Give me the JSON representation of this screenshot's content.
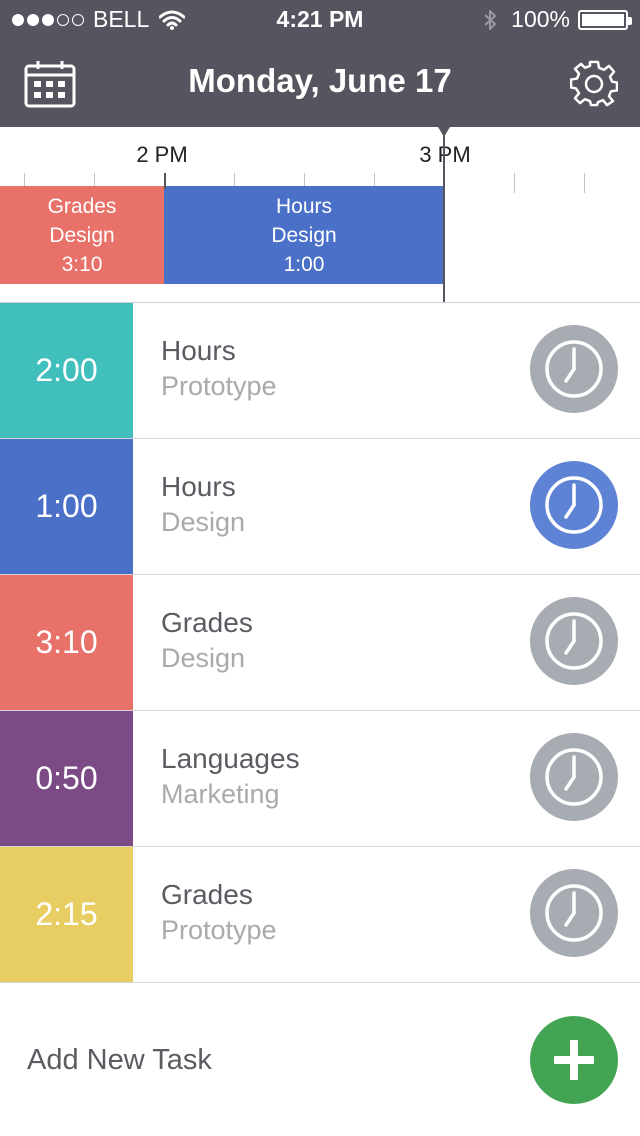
{
  "status_bar": {
    "carrier": "BELL",
    "time": "4:21 PM",
    "battery": "100%",
    "battery_level": 1.0,
    "signal_bars": 3,
    "signal_total": 5
  },
  "nav": {
    "title": "Monday, June 17",
    "calendar_icon": "calendar-icon",
    "settings_icon": "gear-icon"
  },
  "timeline": {
    "labels": [
      "2 PM",
      "3 PM"
    ],
    "blocks": [
      {
        "project": "Grades",
        "type": "Design",
        "duration": "3:10",
        "color": "#e8716a"
      },
      {
        "project": "Hours",
        "type": "Design",
        "duration": "1:00",
        "color": "#4a70c8"
      }
    ]
  },
  "tasks": [
    {
      "duration": "2:00",
      "project": "Hours",
      "type": "Prototype",
      "color": "#40bfbc",
      "active": false
    },
    {
      "duration": "1:00",
      "project": "Hours",
      "type": "Design",
      "color": "#4a70c8",
      "active": true
    },
    {
      "duration": "3:10",
      "project": "Grades",
      "type": "Design",
      "color": "#e8716a",
      "active": false
    },
    {
      "duration": "0:50",
      "project": "Languages",
      "type": "Marketing",
      "color": "#7c4b86",
      "active": false
    },
    {
      "duration": "2:15",
      "project": "Grades",
      "type": "Prototype",
      "color": "#e8cd62",
      "active": false
    }
  ],
  "add_task": {
    "label": "Add New Task",
    "icon": "plus-icon"
  },
  "colors": {
    "header": "#55555f",
    "timer_inactive": "#a7acb3",
    "timer_active": "#5f83d4",
    "add_button": "#43a553"
  }
}
